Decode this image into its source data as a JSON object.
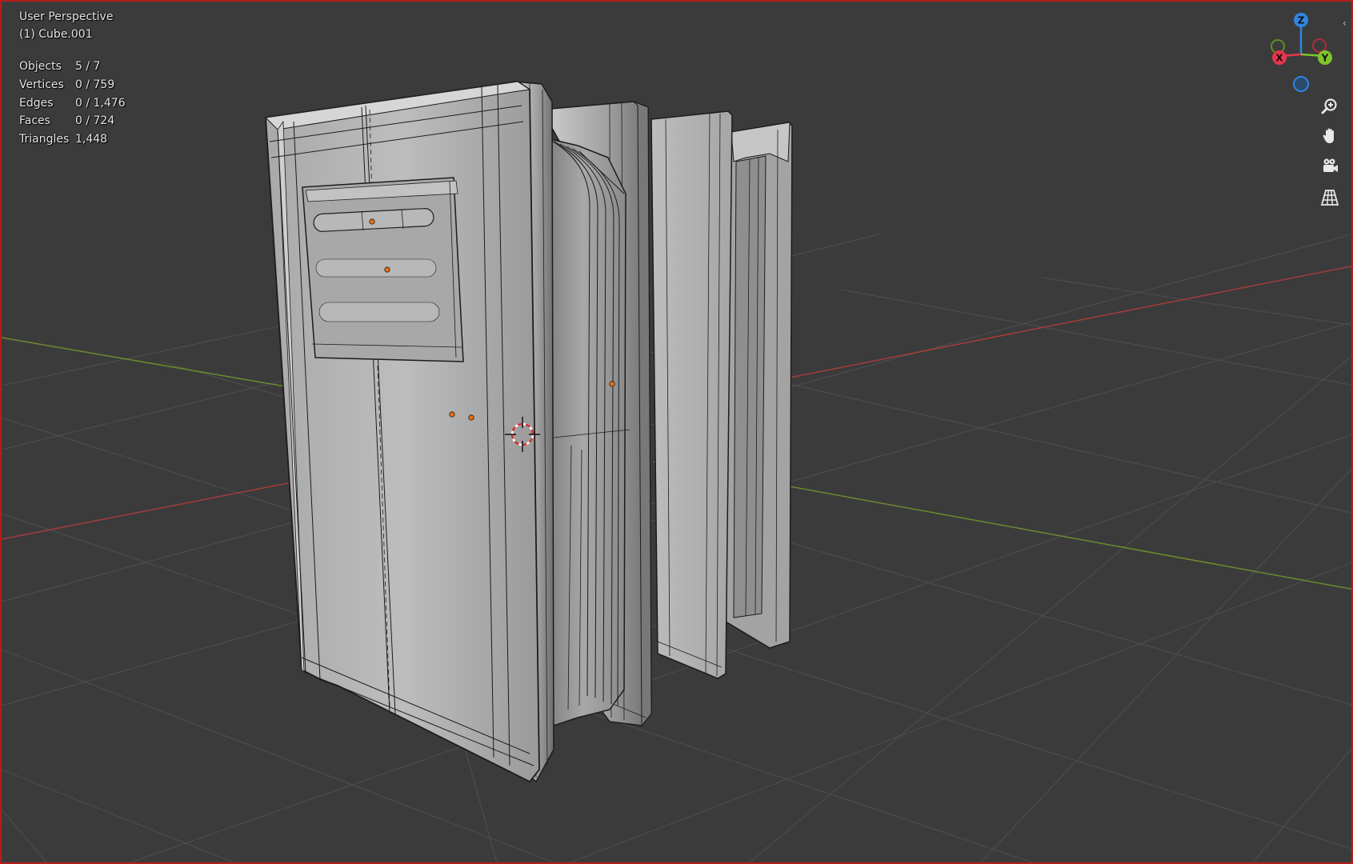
{
  "viewport": {
    "view_name": "User Perspective",
    "active_object": "(1) Cube.001"
  },
  "stats": [
    {
      "label": "Objects",
      "value": "5 / 7"
    },
    {
      "label": "Vertices",
      "value": "0 / 759"
    },
    {
      "label": "Edges",
      "value": "0 / 1,476"
    },
    {
      "label": "Faces",
      "value": "0 / 724"
    },
    {
      "label": "Triangles",
      "value": "1,448"
    }
  ],
  "gizmo": {
    "z_label": "Z",
    "x_label": "X",
    "y_label": "Y",
    "colors": {
      "x": "#e8354f",
      "y": "#7ec42b",
      "z": "#2f86de"
    }
  },
  "nav_buttons": [
    {
      "name": "zoom-icon",
      "label": "zoom"
    },
    {
      "name": "hand-pan-icon",
      "label": "pan"
    },
    {
      "name": "camera-icon",
      "label": "camera"
    },
    {
      "name": "grid-ortho-icon",
      "label": "perspective"
    }
  ],
  "colors": {
    "background": "#3b3b3b",
    "grid": "#4c4c4c",
    "x_axis": "#a43c3c",
    "y_axis": "#6b8b2c",
    "model_fill": "#b4b4b4",
    "wire": "#1c1c1c",
    "origin_dot": "#e0701a",
    "border": "#b81c1c"
  }
}
